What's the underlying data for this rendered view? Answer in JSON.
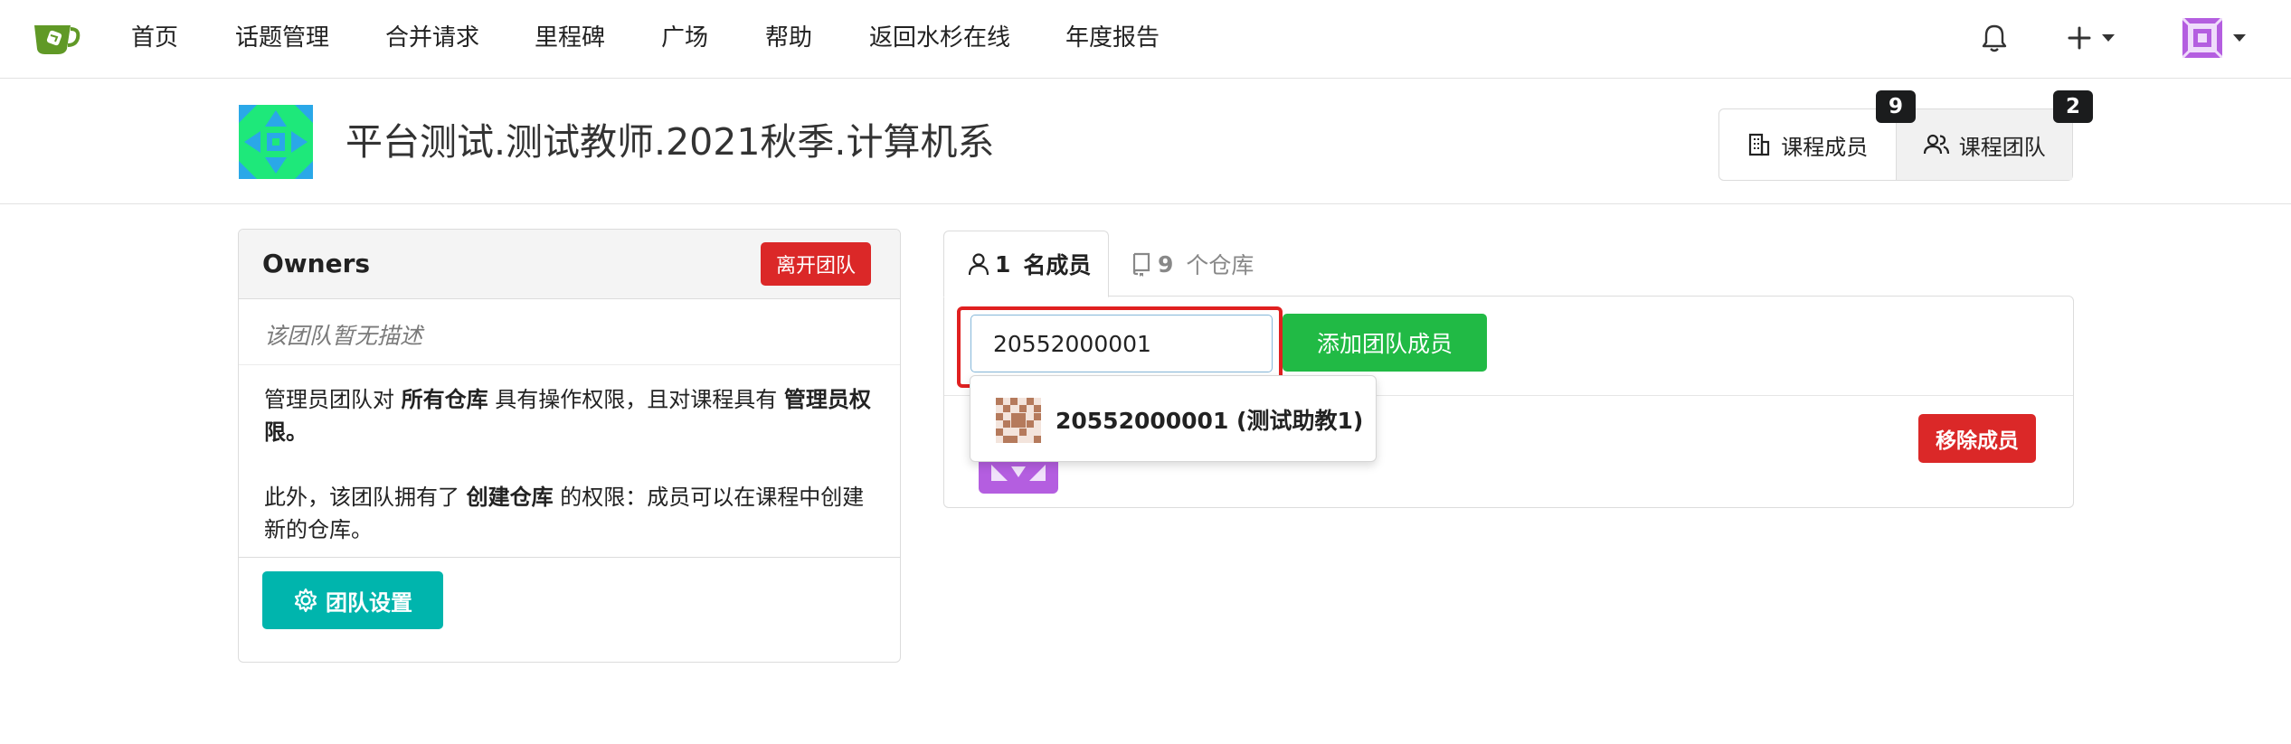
{
  "nav": {
    "items": [
      "首页",
      "话题管理",
      "合并请求",
      "里程碑",
      "广场",
      "帮助",
      "返回水杉在线",
      "年度报告"
    ]
  },
  "icons": {
    "logo": "tea-cup-logo-icon",
    "notification": "bell-icon",
    "create": "plus-icon",
    "user": "user-avatar-icon",
    "members": "building-icon",
    "team": "people-icon",
    "settings": "gear-icon",
    "member_tab": "person-icon",
    "repo_tab": "repo-book-icon"
  },
  "colors": {
    "danger": "#db2828",
    "teal": "#00b5ad",
    "success": "#21ba45",
    "highlight": "#e02020"
  },
  "course": {
    "title": "平台测试.测试教师.2021秋季.计算机系",
    "members_label": "课程成员",
    "members_count": "9",
    "team_label": "课程团队",
    "team_count": "2"
  },
  "team": {
    "name": "Owners",
    "leave_label": "离开团队",
    "description": "该团队暂无描述",
    "perm1": [
      "管理员团队对 ",
      "所有仓库",
      " 具有操作权限，且对课程具有 ",
      "管理员权限",
      "。"
    ],
    "perm2": [
      "此外，该团队拥有了 ",
      "创建仓库",
      " 的权限：成员可以在课程中创建新的仓库。"
    ],
    "settings_label": "团队设置"
  },
  "tabs": {
    "members_num": "1",
    "members_label": "名成员",
    "repos_num": "9",
    "repos_label": "个仓库"
  },
  "members": {
    "search_value": "20552000001",
    "add_label": "添加团队成员",
    "remove_label": "移除成员",
    "suggestion": "20552000001 (测试助教1)"
  }
}
